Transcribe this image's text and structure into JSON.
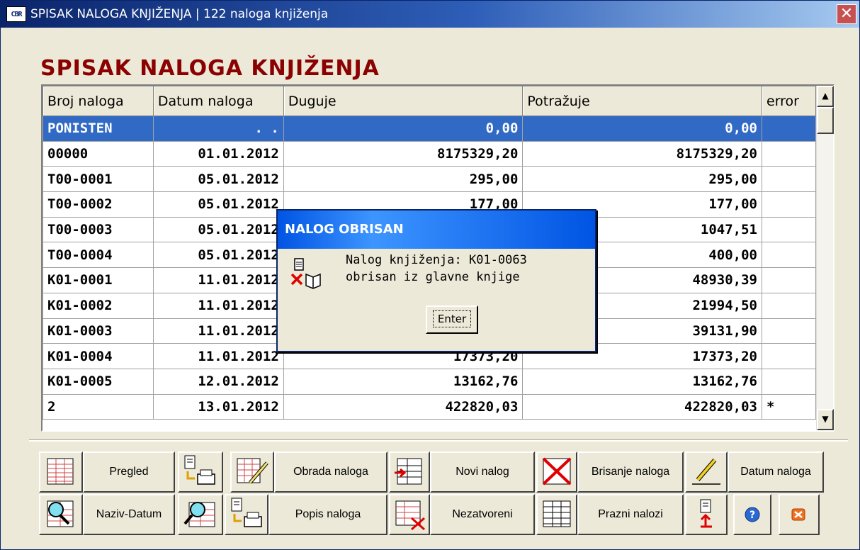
{
  "window": {
    "title": "SPISAK NALOGA KNJIŽENJA | 122 naloga knjiženja",
    "app_icon": "CBR",
    "close_glyph": "✕"
  },
  "heading": "SPISAK NALOGA KNJIŽENJA",
  "grid": {
    "columns": [
      "Broj naloga",
      "Datum naloga",
      "Duguje",
      "Potražuje",
      "error"
    ],
    "rows": [
      {
        "broj": "PONISTEN",
        "datum": ". .",
        "duguje": "0,00",
        "potrazuje": "0,00",
        "error": ""
      },
      {
        "broj": "00000",
        "datum": "01.01.2012",
        "duguje": "8175329,20",
        "potrazuje": "8175329,20",
        "error": ""
      },
      {
        "broj": "T00-0001",
        "datum": "05.01.2012",
        "duguje": "295,00",
        "potrazuje": "295,00",
        "error": ""
      },
      {
        "broj": "T00-0002",
        "datum": "05.01.2012",
        "duguje": "177,00",
        "potrazuje": "177,00",
        "error": ""
      },
      {
        "broj": "T00-0003",
        "datum": "05.01.2012",
        "duguje": "",
        "potrazuje": "1047,51",
        "error": ""
      },
      {
        "broj": "T00-0004",
        "datum": "05.01.2012",
        "duguje": "",
        "potrazuje": "400,00",
        "error": ""
      },
      {
        "broj": "K01-0001",
        "datum": "11.01.2012",
        "duguje": "",
        "potrazuje": "48930,39",
        "error": ""
      },
      {
        "broj": "K01-0002",
        "datum": "11.01.2012",
        "duguje": "",
        "potrazuje": "21994,50",
        "error": ""
      },
      {
        "broj": "K01-0003",
        "datum": "11.01.2012",
        "duguje": "",
        "potrazuje": "39131,90",
        "error": ""
      },
      {
        "broj": "K01-0004",
        "datum": "11.01.2012",
        "duguje": "17373,20",
        "potrazuje": "17373,20",
        "error": ""
      },
      {
        "broj": "K01-0005",
        "datum": "12.01.2012",
        "duguje": "13162,76",
        "potrazuje": "13162,76",
        "error": ""
      },
      {
        "broj": "2",
        "datum": "13.01.2012",
        "duguje": "422820,03",
        "potrazuje": "422820,03",
        "error": "*"
      }
    ],
    "scroll_up": "▲",
    "scroll_down": "▼"
  },
  "dialog": {
    "title": "NALOG OBRISAN",
    "message_line1": "Nalog knjiženja: K01-0063",
    "message_line2": "obrisan iz glavne knjige",
    "button": "Enter"
  },
  "toolbar": {
    "pregled": "Pregled",
    "obrada": "Obrada naloga",
    "novi": "Novi nalog",
    "brisanje": "Brisanje naloga",
    "datum": "Datum naloga",
    "naziv_datum": "Naziv-Datum",
    "popis": "Popis naloga",
    "nezatvoreni": "Nezatvoreni",
    "prazni": "Prazni nalozi"
  },
  "colors": {
    "heading": "#8b0000",
    "selection": "#316ac5",
    "titlebar": "#0a246a",
    "dialog_title": "#0054e3"
  }
}
